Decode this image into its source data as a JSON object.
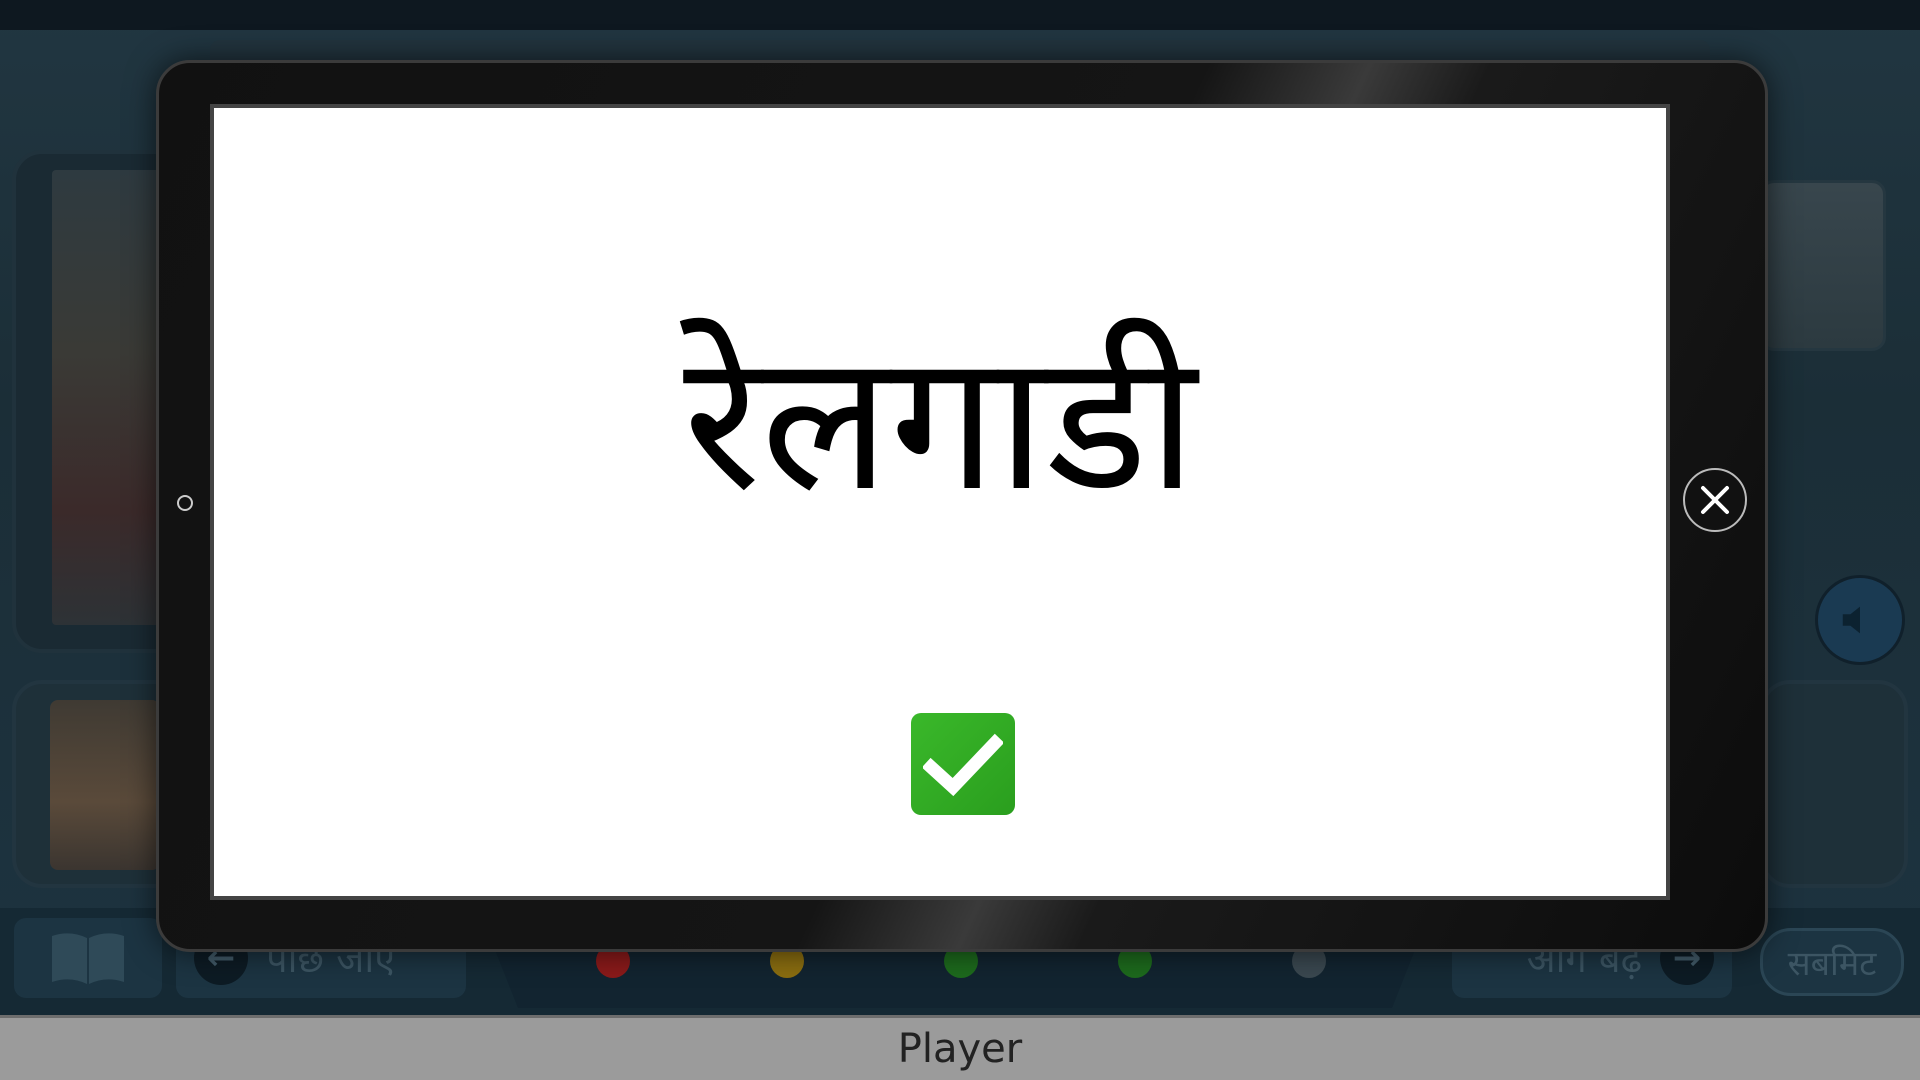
{
  "app": {
    "back_label": "पीछे जाएं",
    "next_label": "आगे बढ़ें",
    "submit_label": "सबमिट",
    "progress_dots": [
      {
        "color": "#8a1a1a"
      },
      {
        "color": "#8a6d10"
      },
      {
        "color": "#1d6a1d"
      },
      {
        "color": "#1d6a1d"
      },
      {
        "color": "#3a4850"
      }
    ]
  },
  "modal": {
    "word": "रेलगाडी",
    "result": "correct",
    "close_icon": "close-icon",
    "check_icon": "checkmark-icon"
  },
  "window": {
    "title": "Player"
  }
}
